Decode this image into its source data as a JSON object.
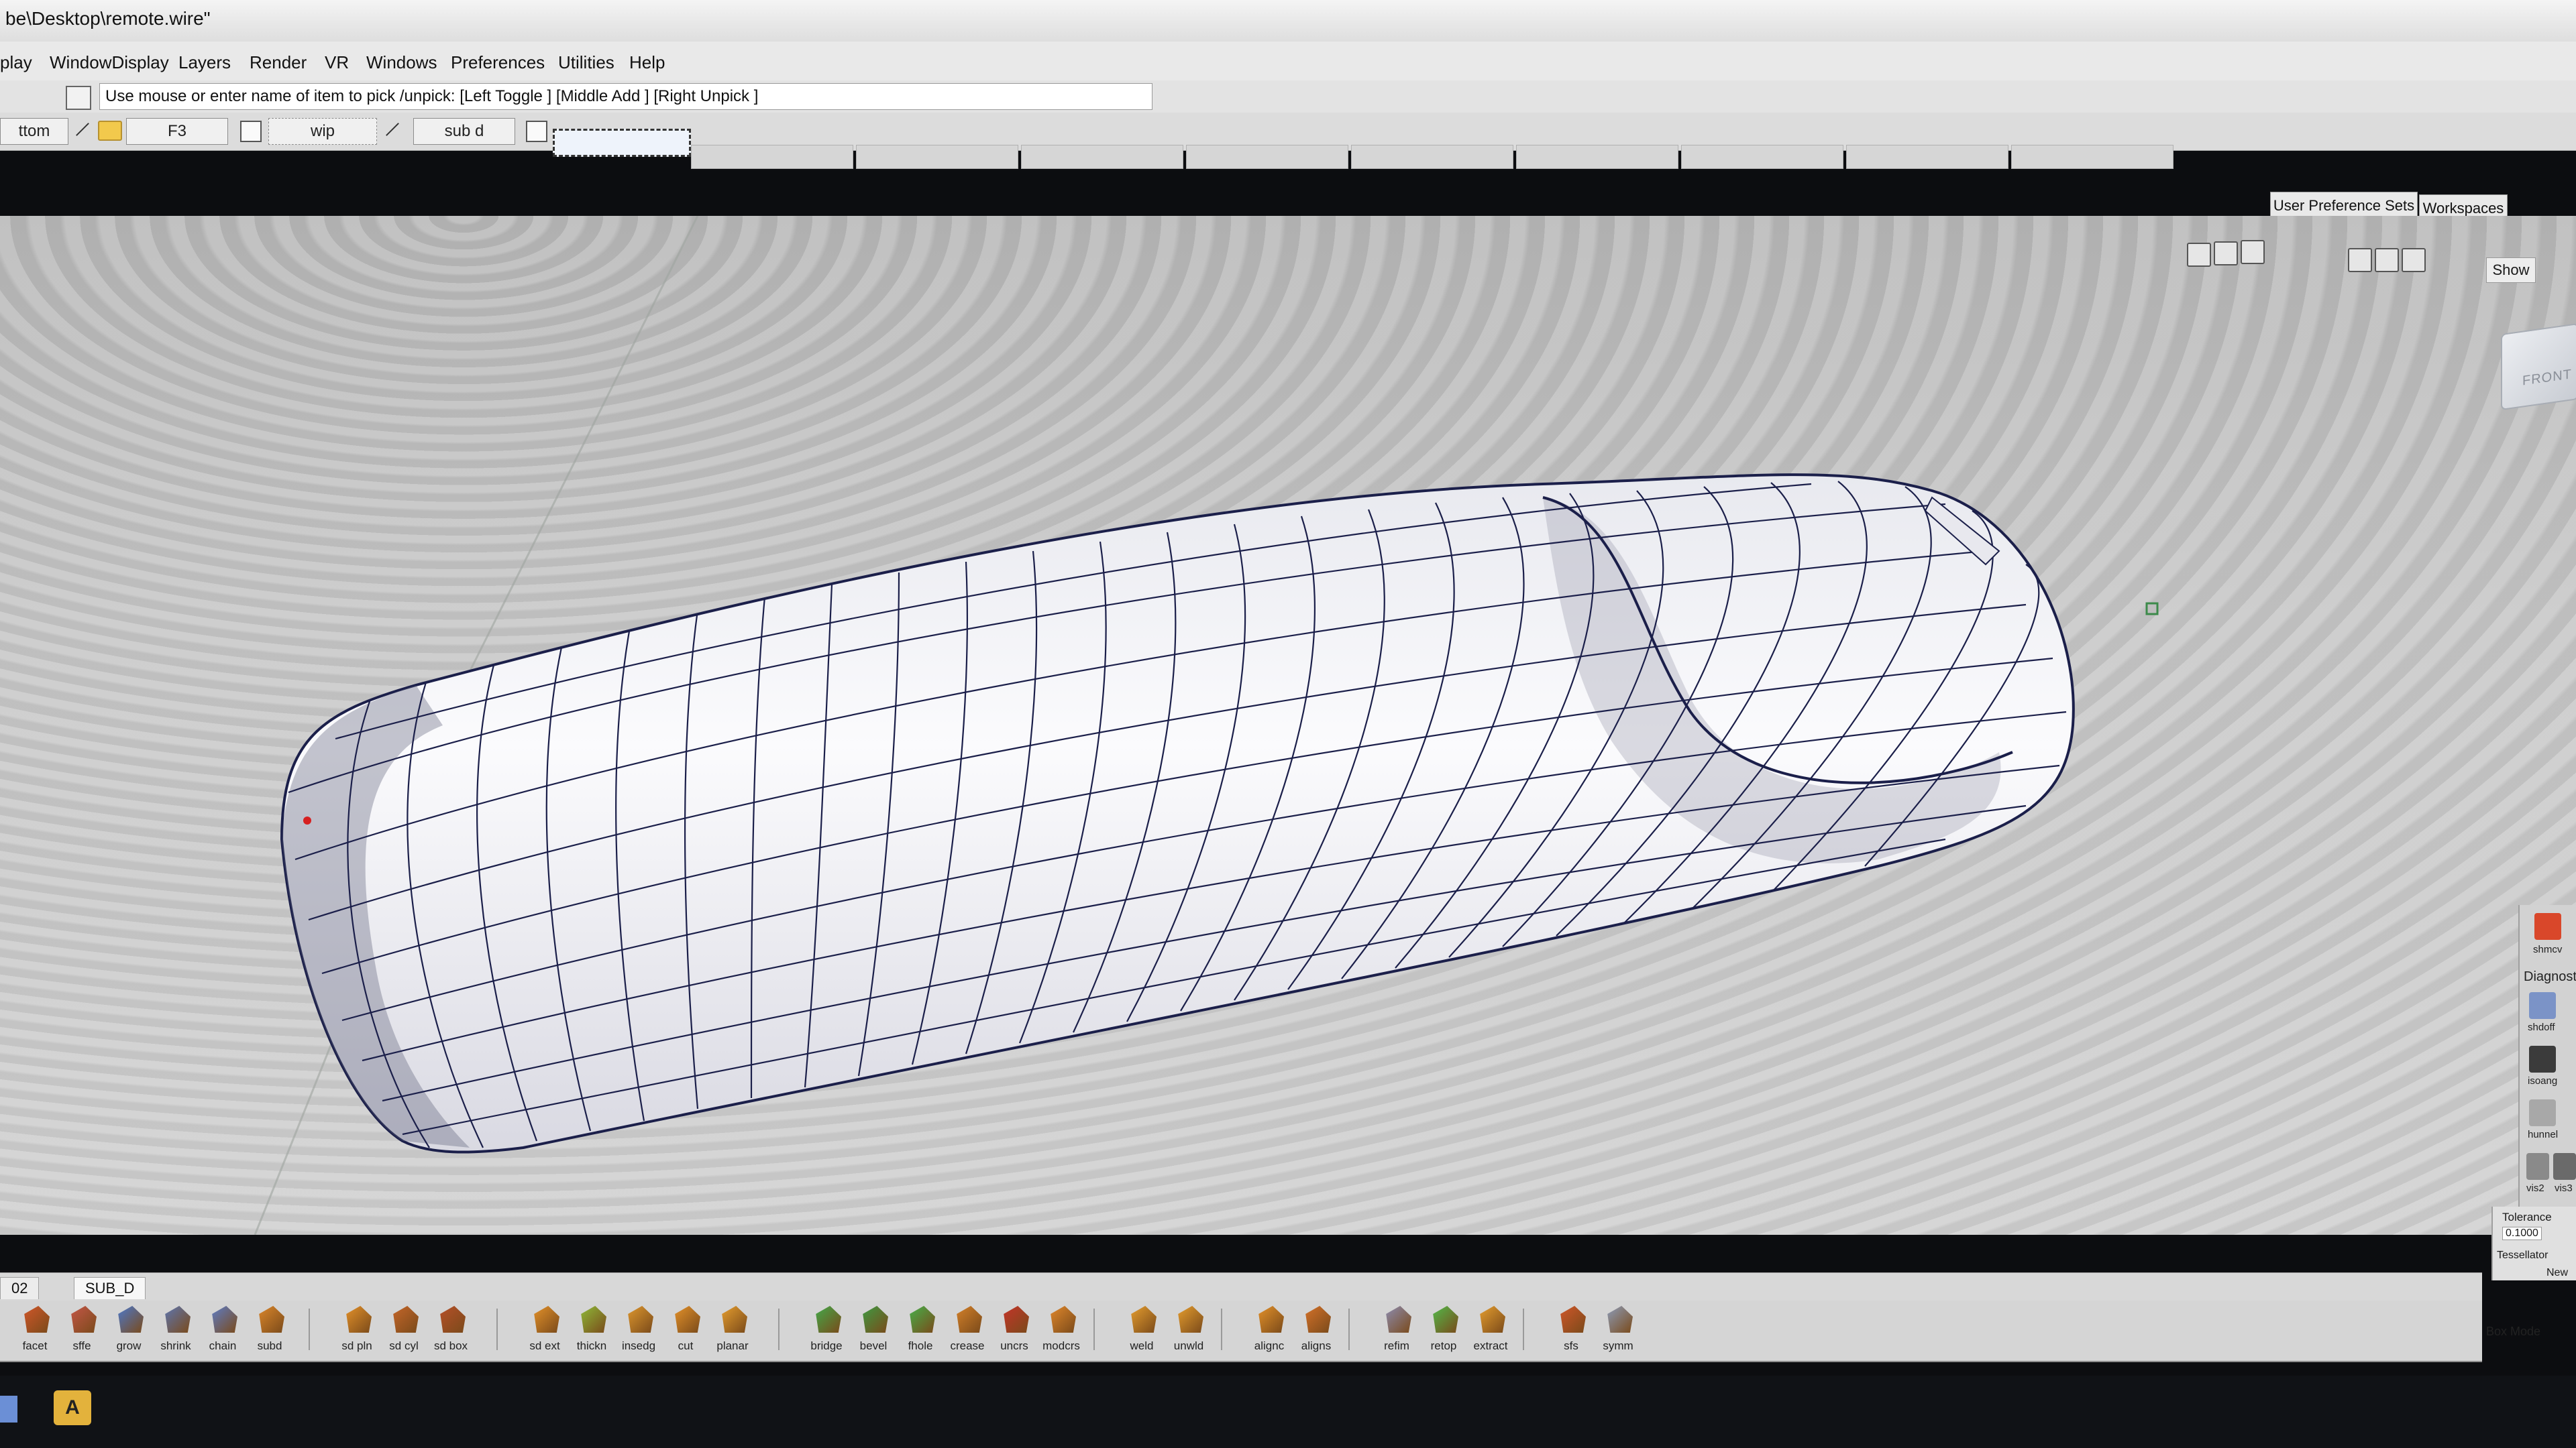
{
  "window": {
    "title": "be\\Desktop\\remote.wire\""
  },
  "menu": [
    "play",
    "WindowDisplay",
    "Layers",
    "Render",
    "VR",
    "Windows",
    "Preferences",
    "Utilities",
    "Help"
  ],
  "pickbar": {
    "prompt": "Use mouse or enter name of item to pick /unpick: [Left Toggle ] [Middle Add ] [Right Unpick ]"
  },
  "toolrow": {
    "left_label": "ttom",
    "f3_label": "F3",
    "wip_label": "wip",
    "subd_label": "sub d"
  },
  "right_tabs": {
    "user_pref_sets": "User Preference Sets",
    "workspaces": "Workspaces",
    "show": "Show"
  },
  "viewcube": {
    "label": "FRONT"
  },
  "right_palette": {
    "diagnostics_title": "Diagnost",
    "tools": [
      "shmcv",
      "shdoff",
      "isoang",
      "hunnel",
      "vis2",
      "vis3"
    ]
  },
  "tolerance": {
    "label": "Tolerance",
    "value": "0.1000",
    "tessellator": "Tessellator",
    "new": "New"
  },
  "shelf": {
    "tabs": [
      "02",
      "SUB_D"
    ],
    "tools": [
      {
        "label": "facet",
        "color": "#d4572a"
      },
      {
        "label": "sffe",
        "color": "#c8574a"
      },
      {
        "label": "grow",
        "color": "#4a7bd4"
      },
      {
        "label": "shrink",
        "color": "#5b78b8"
      },
      {
        "label": "chain",
        "color": "#5c7fcf"
      },
      {
        "label": "subd",
        "color": "#e08a2c"
      },
      {
        "label": "sd pln",
        "color": "#e8942a"
      },
      {
        "label": "sd cyl",
        "color": "#c8672a"
      },
      {
        "label": "sd box",
        "color": "#b9502a"
      },
      {
        "label": "sd ext",
        "color": "#e8942a"
      },
      {
        "label": "thickn",
        "color": "#8fbf3a"
      },
      {
        "label": "insedg",
        "color": "#e39b2f"
      },
      {
        "label": "cut",
        "color": "#e8942a"
      },
      {
        "label": "planar",
        "color": "#eaa12f"
      },
      {
        "label": "bridge",
        "color": "#3fae4c"
      },
      {
        "label": "bevel",
        "color": "#3b9e44"
      },
      {
        "label": "fhole",
        "color": "#43b54c"
      },
      {
        "label": "crease",
        "color": "#d8832a"
      },
      {
        "label": "uncrs",
        "color": "#c8332a"
      },
      {
        "label": "modcrs",
        "color": "#e58a2c"
      },
      {
        "label": "weld",
        "color": "#eaa12f"
      },
      {
        "label": "unwld",
        "color": "#eaa12f"
      },
      {
        "label": "alignc",
        "color": "#e8942a"
      },
      {
        "label": "aligns",
        "color": "#d8732a"
      },
      {
        "label": "refim",
        "color": "#8d8fb8"
      },
      {
        "label": "retop",
        "color": "#4fbf4c"
      },
      {
        "label": "extract",
        "color": "#eaa12f"
      },
      {
        "label": "sfs",
        "color": "#d4572a"
      },
      {
        "label": "symm",
        "color": "#8da0c0"
      }
    ],
    "box_mode": "Box Mode"
  },
  "taskbar": {
    "app_letter": "A"
  },
  "colors": {
    "viewport_bg": "#c2c2c2",
    "mesh_line": "#1b1f4a",
    "surface": "#f2f2f6"
  }
}
